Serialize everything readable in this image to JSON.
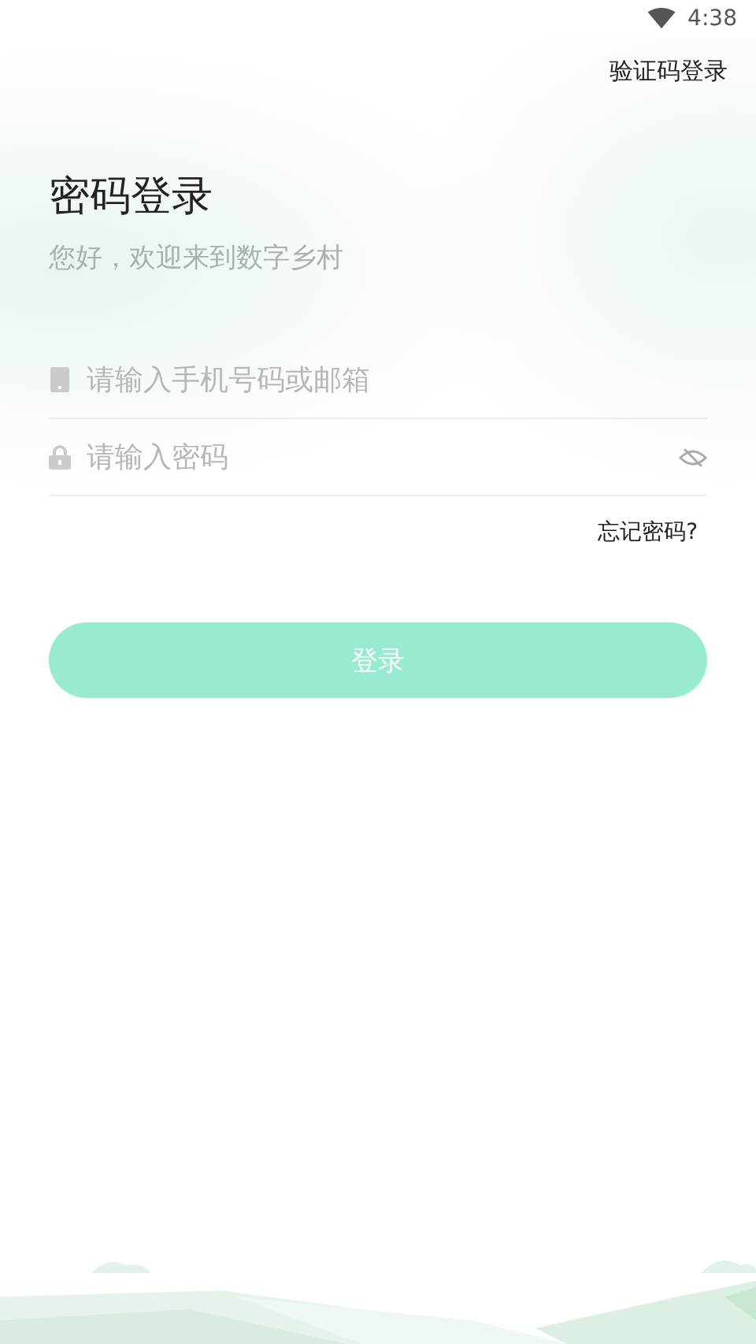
{
  "status_bar": {
    "time": "4:38"
  },
  "header": {
    "switch_link": "验证码登录"
  },
  "title": "密码登录",
  "subtitle": "您好，欢迎来到数字乡村",
  "fields": [
    {
      "kind": "account",
      "placeholder": "请输入手机号码或邮箱"
    },
    {
      "kind": "password",
      "placeholder": "请输入密码",
      "password_visible": false
    }
  ],
  "forgot_link": "忘记密码?",
  "login_button": {
    "label": "登录",
    "disabled": true
  }
}
